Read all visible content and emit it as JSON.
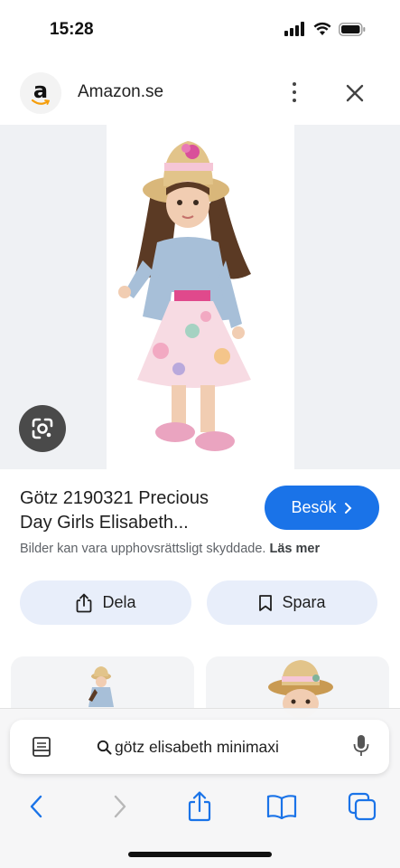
{
  "status_bar": {
    "time": "15:28"
  },
  "site": {
    "name": "Amazon.se",
    "logo_letter": "a"
  },
  "product": {
    "title_line1": "Götz 2190321 Precious",
    "title_line2": "Day Girls Elisabeth...",
    "visit_label": "Besök",
    "copyright_text": "Bilder kan vara upphovsrättsligt skyddade.",
    "learn_more": "Läs mer"
  },
  "actions": {
    "share_label": "Dela",
    "save_label": "Spara"
  },
  "address_bar": {
    "query": "götz elisabeth minimaxi"
  },
  "icons": {
    "signal": "signal-icon",
    "wifi": "wifi-icon",
    "battery": "battery-icon",
    "more": "more-vert-icon",
    "close": "close-icon",
    "lens": "google-lens-icon",
    "share": "share-icon",
    "bookmark": "bookmark-icon",
    "reader": "reader-icon",
    "search": "search-icon",
    "mic": "mic-icon",
    "back": "back-icon",
    "forward": "forward-icon",
    "book": "bookmarks-book-icon",
    "tabs": "tabs-icon"
  },
  "colors": {
    "accent": "#1a73e8",
    "pill_bg": "#e8eefa",
    "safari_blue": "#1a73e8"
  }
}
